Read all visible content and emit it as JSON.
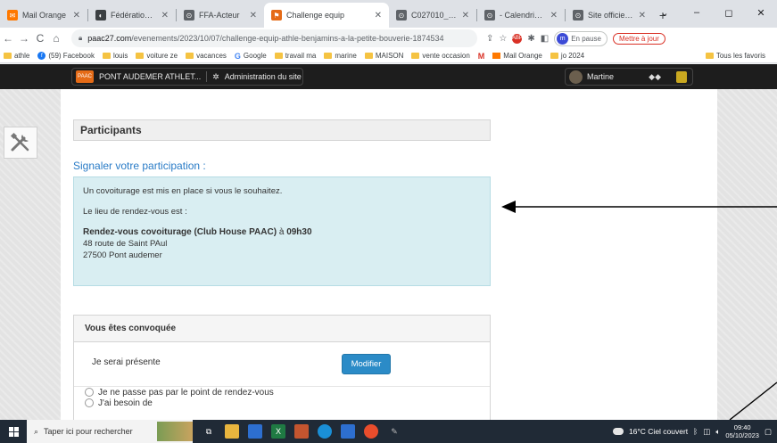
{
  "browser": {
    "tabs": [
      {
        "title": "Mail Orange",
        "icon": "mail-orange-icon",
        "color": "#ff7900",
        "glyph": "✉"
      },
      {
        "title": "Fédération Franç",
        "icon": "ffa-icon",
        "color": "#3c4043",
        "glyph": "◐"
      },
      {
        "title": "FFA-Acteur",
        "icon": "globe-icon",
        "color": "#5f6368",
        "glyph": "⊙"
      },
      {
        "title": "Challenge equip",
        "icon": "paac-icon",
        "color": "#e56b17",
        "glyph": "⚑",
        "active": true
      },
      {
        "title": "C027010_ADM F",
        "icon": "globe-icon",
        "color": "#5f6368",
        "glyph": "⊙"
      },
      {
        "title": "- Calendrier Régi",
        "icon": "globe-icon",
        "color": "#5f6368",
        "glyph": "⊙"
      },
      {
        "title": "Site officiel de la",
        "icon": "globe-icon",
        "color": "#5f6368",
        "glyph": "⊙"
      }
    ],
    "new_tab": "+",
    "window_controls": {
      "dropdown": "⌄",
      "minimize": "–",
      "maximize": "◻",
      "close": "✕"
    },
    "url_host": "paac27.com",
    "url_path": "/evenements/2023/10/07/challenge-equip-athle-benjamins-a-la-petite-bouverie-1874534",
    "profile_initial": "m",
    "profile_status": "En pause",
    "update_label": "Mettre à jour",
    "bookmarks": [
      {
        "label": "athle",
        "type": "folder"
      },
      {
        "label": "(59) Facebook",
        "type": "facebook"
      },
      {
        "label": "louis",
        "type": "folder"
      },
      {
        "label": "voiture ze",
        "type": "folder"
      },
      {
        "label": "vacances",
        "type": "folder"
      },
      {
        "label": "Google",
        "type": "google"
      },
      {
        "label": "travail ma",
        "type": "folder"
      },
      {
        "label": "marine",
        "type": "folder"
      },
      {
        "label": "MAISON",
        "type": "folder"
      },
      {
        "label": "vente occasion",
        "type": "folder"
      },
      {
        "label": "",
        "type": "gmail"
      },
      {
        "label": "Mail Orange",
        "type": "orange"
      },
      {
        "label": "jo 2024",
        "type": "folder"
      }
    ],
    "bookmarks_all": "Tous les favoris"
  },
  "adminbar": {
    "site_name": "PONT AUDEMER ATHLET...",
    "admin_label": "Administration du site",
    "user_name": "Martine"
  },
  "content": {
    "section_title": "Participants",
    "signal_link": "Signaler votre participation :",
    "info": {
      "line1": "Un covoiturage est mis en place si vous le souhaitez.",
      "line2": "Le lieu de rendez-vous est :",
      "rdv_title": "Rendez-vous covoiturage (Club House PAAC)",
      "rdv_at": " à ",
      "rdv_time": "09h30",
      "address1": "48 route de Saint PAul",
      "address2": "27500 Pont audemer"
    },
    "panel": {
      "title": "Vous êtes convoquée",
      "status": "Je serai présente",
      "modify_button": "Modifier",
      "options": [
        "Je ne passe pas par le point de rendez-vous",
        "J'ai besoin de"
      ]
    }
  },
  "taskbar": {
    "search_placeholder": "Taper ici pour rechercher",
    "weather": "16°C  Ciel couvert",
    "time": "09:40",
    "date": "05/10/2023"
  }
}
